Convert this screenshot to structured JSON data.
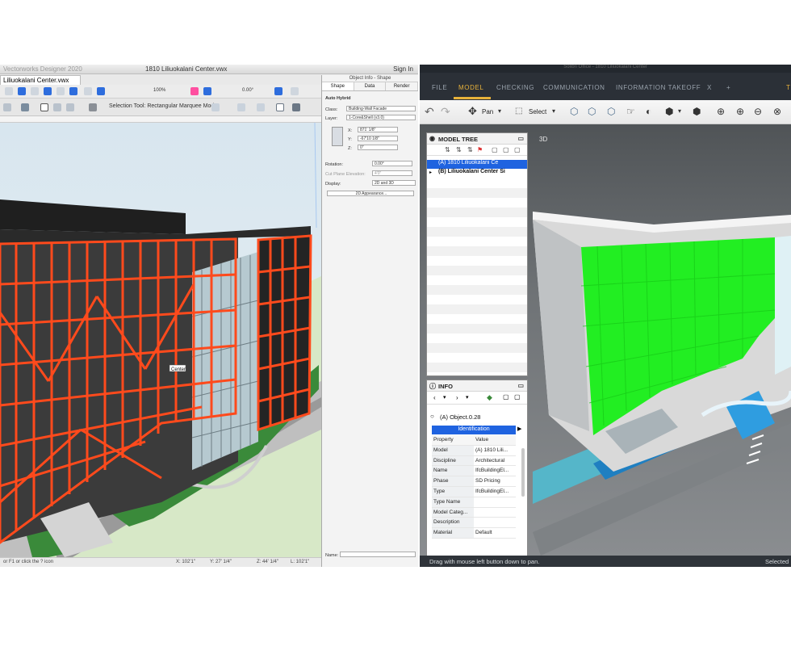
{
  "left_app": {
    "app_title": "Vectorworks Designer 2020",
    "doc_title": "1810 Liliuokalani Center.vwx",
    "sign_in": "Sign In",
    "doc_tab": "Liliuokalani Center.vwx",
    "zoom": "100%",
    "angle": "0.00°",
    "selection_hint": "Selection Tool: Rectangular Marquee Mode",
    "viewport_label": "Center",
    "status_left": "or F1 or click the ? icon",
    "status_x": "X: 102'1\"",
    "status_y": "Y: 27' 1/4\"",
    "status_z": "Z: 44' 1/4\"",
    "status_l": "L: 102'1\""
  },
  "object_info": {
    "title": "Object Info - Shape",
    "tabs": [
      "Shape",
      "Data",
      "Render"
    ],
    "object_type": "Auto Hybrid",
    "class_label": "Class:",
    "class_value": "Building-Wall Facade",
    "layer_label": "Layer:",
    "layer_value": "1-Core&Shell (v3.0)",
    "x_label": "X:",
    "x_value": "871' 1/8\"",
    "y_label": "Y:",
    "y_value": "-67'10 1/8\"",
    "z_label": "Z:",
    "z_value": "0\"",
    "rotation_label": "Rotation:",
    "rotation_value": "0.00°",
    "cut_label": "Cut Plane Elevation:",
    "cut_value": "4'0\"",
    "display_label": "Display:",
    "display_value": "2D and 3D",
    "appearance_button": "2D Appearance...",
    "name_label": "Name:"
  },
  "right_app": {
    "window_title": "Solibri Office - 1810 Liliuokalani Center",
    "menu": [
      "FILE",
      "MODEL",
      "CHECKING",
      "COMMUNICATION",
      "INFORMATION TAKEOFF"
    ],
    "active_menu": "MODEL",
    "menu_more": "X",
    "menu_add": "+",
    "menu_cut": "T",
    "pan_label": "Pan",
    "select_label": "Select",
    "view_label": "3D",
    "status_left": "Drag with mouse left button down to pan.",
    "status_right": "Selected"
  },
  "model_tree": {
    "title": "MODEL TREE",
    "items": [
      "(A) 1810 Liliuokalani Ce",
      "(B) Liliuokalani Center Si"
    ]
  },
  "info_panel": {
    "title": "INFO",
    "object_name": "(A) Object.0.28",
    "tab": "Identification",
    "header": [
      "Property",
      "Value"
    ],
    "rows": [
      [
        "Model",
        "(A) 1810 Lili..."
      ],
      [
        "Discipline",
        "Architectural"
      ],
      [
        "Name",
        "IfcBuildingEl..."
      ],
      [
        "Phase",
        "SD Pricing"
      ],
      [
        "Type",
        "IfcBuildingEl..."
      ],
      [
        "Type Name",
        ""
      ],
      [
        "Model Categ...",
        ""
      ],
      [
        "Description",
        ""
      ],
      [
        "Material",
        "Default"
      ]
    ]
  },
  "colors": {
    "facade_orange": "#ff4a1c",
    "facade_green": "#22ee22",
    "selection_blue": "#2f6fe6",
    "accent_menu": "#e8b23a"
  }
}
